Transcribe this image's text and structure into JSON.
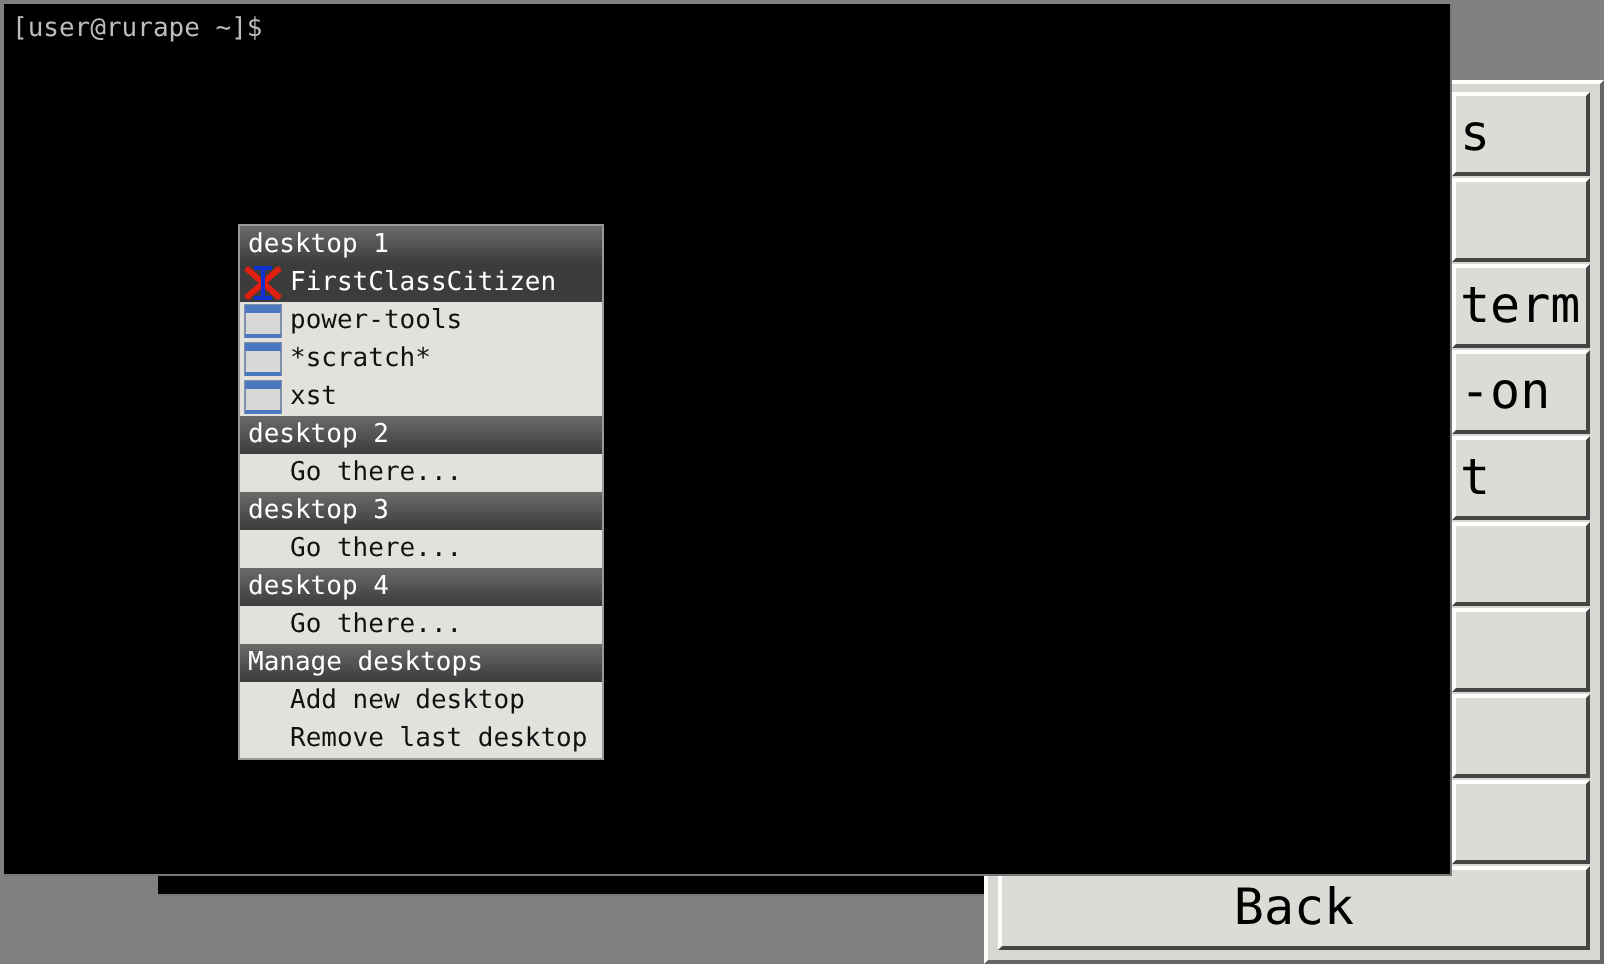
{
  "terminal": {
    "prompt": "[user@rurape ~]$"
  },
  "menu": [
    {
      "title": "desktop 1",
      "items": [
        {
          "label": "FirstClassCitizen",
          "kind": "x-app",
          "selected": true
        },
        {
          "label": "power-tools",
          "kind": "window",
          "selected": false
        },
        {
          "label": "*scratch*",
          "kind": "window",
          "selected": false
        },
        {
          "label": "xst",
          "kind": "window",
          "selected": false
        }
      ]
    },
    {
      "title": "desktop 2",
      "items": [
        {
          "label": "Go there...",
          "kind": "action",
          "selected": false
        }
      ]
    },
    {
      "title": "desktop 3",
      "items": [
        {
          "label": "Go there...",
          "kind": "action",
          "selected": false
        }
      ]
    },
    {
      "title": "desktop 4",
      "items": [
        {
          "label": "Go there...",
          "kind": "action",
          "selected": false
        }
      ]
    },
    {
      "title": "Manage desktops",
      "items": [
        {
          "label": "Add new desktop",
          "kind": "action",
          "selected": false
        },
        {
          "label": "Remove last desktop",
          "kind": "action",
          "selected": false
        }
      ]
    }
  ],
  "panel_buttons": [
    {
      "label": "s",
      "kind": "cut"
    },
    {
      "kind": "blank"
    },
    {
      "label": "term",
      "kind": "cut"
    },
    {
      "label": "-on",
      "kind": "cut"
    },
    {
      "label": "t",
      "kind": "cut"
    },
    {
      "kind": "blank"
    },
    {
      "kind": "blank"
    },
    {
      "kind": "blank"
    },
    {
      "kind": "blank"
    },
    {
      "label": "Back",
      "kind": "full"
    }
  ]
}
